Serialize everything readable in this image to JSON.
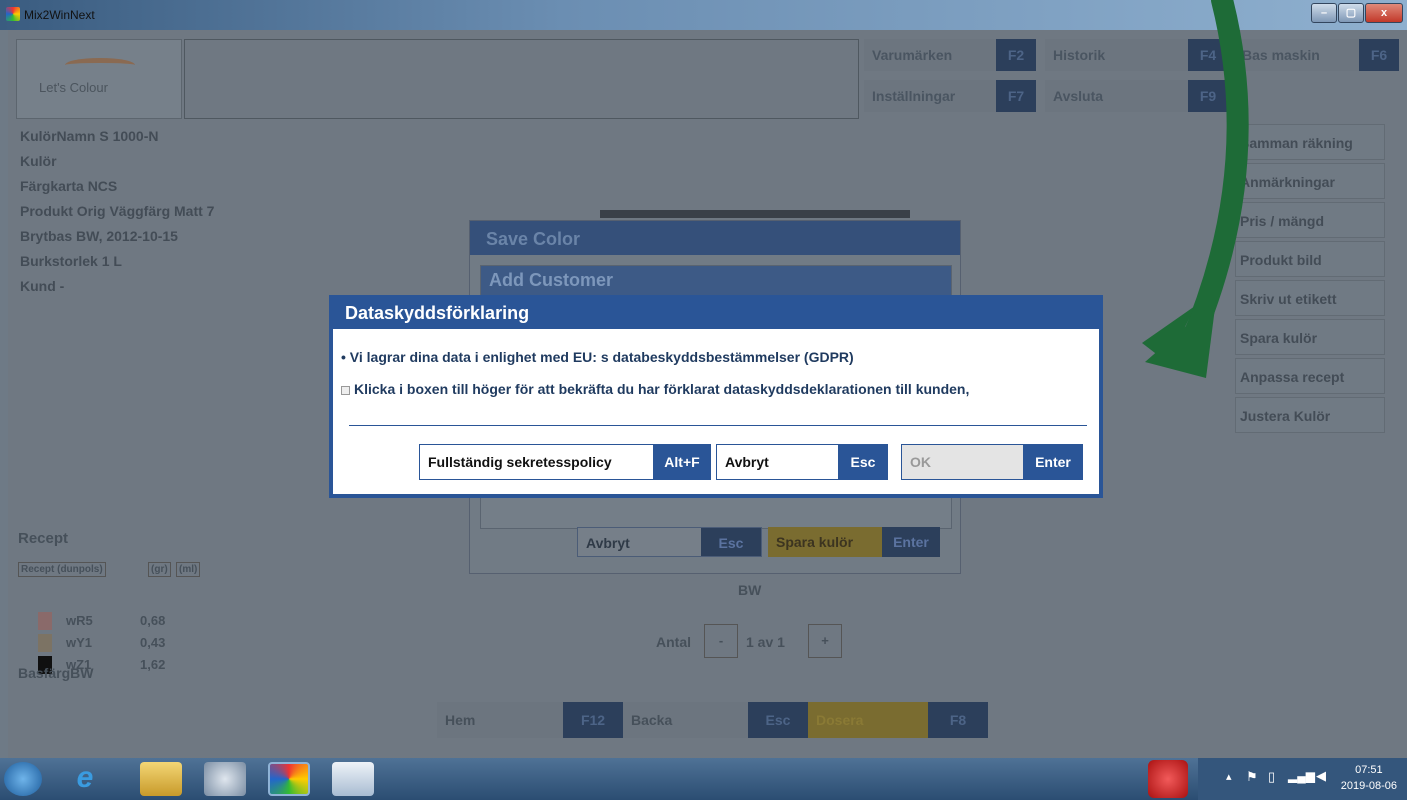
{
  "window": {
    "title": "Mix2WinNext",
    "min": "–",
    "max": "▢",
    "close": "x"
  },
  "logo": "Let's Colour",
  "topkeys": [
    {
      "label": "Varumärken",
      "key": "F2"
    },
    {
      "label": "Historik",
      "key": "F4"
    },
    {
      "label": "Bas maskin",
      "key": "F6"
    },
    {
      "label": "Inställningar",
      "key": "F7"
    },
    {
      "label": "Avsluta",
      "key": "F9"
    }
  ],
  "info": [
    "KulörNamn  S 1000-N",
    "Kulör",
    "Färgkarta    NCS",
    "Produkt      Orig Väggfärg Matt 7",
    "Brytbas      BW, 2012-10-15",
    "Burkstorlek 1 L",
    "Kund          -"
  ],
  "right_buttons": [
    "Samman räkning",
    "Anmärkningar",
    "Pris / mängd",
    "Produkt bild",
    "Skriv ut etikett",
    "Spara kulör",
    "Anpassa recept",
    "Justera Kulör"
  ],
  "recipe": {
    "title": "Recept",
    "headers": [
      "Recept (dunpols)",
      "(gr)",
      "(ml)"
    ],
    "rows": [
      {
        "name": "wR5",
        "value": "0,68",
        "color": "#8a6a6a"
      },
      {
        "name": "wY1",
        "value": "0,43",
        "color": "#7c7364"
      },
      {
        "name": "wZ1",
        "value": "1,62",
        "color": "#101010"
      }
    ],
    "base": "BasfärgBW"
  },
  "center": {
    "base": "BW",
    "antal": "Antal",
    "minus": "-",
    "count": "1 av 1",
    "plus": "+"
  },
  "bottom_buttons": [
    {
      "label": "Hem",
      "key": "F12"
    },
    {
      "label": "Backa",
      "key": "Esc"
    },
    {
      "label": "Dosera",
      "key": "F8"
    }
  ],
  "save_color": {
    "title": "Save Color",
    "add_customer": "Add Customer",
    "cancel": "Avbryt",
    "cancel_key": "Esc",
    "save": "Spara kulör",
    "save_key": "Enter"
  },
  "dialog": {
    "title": "Dataskyddsförklaring",
    "line1": "• Vi lagrar dina data i enlighet med EU: s databeskyddsbestämmelser (GDPR)",
    "line2": "Klicka i boxen till höger för att bekräfta du har förklarat dataskyddsdeklarationen till kunden,",
    "policy": "Fullständig sekretesspolicy",
    "policy_key": "Alt+F",
    "cancel": "Avbryt",
    "cancel_key": "Esc",
    "ok": "OK",
    "ok_key": "Enter"
  },
  "taskbar": {
    "time": "07:51",
    "date": "2019-08-06"
  },
  "colors": {
    "dialog_blue": "#2a5597",
    "arrow": "#1e6b37"
  }
}
